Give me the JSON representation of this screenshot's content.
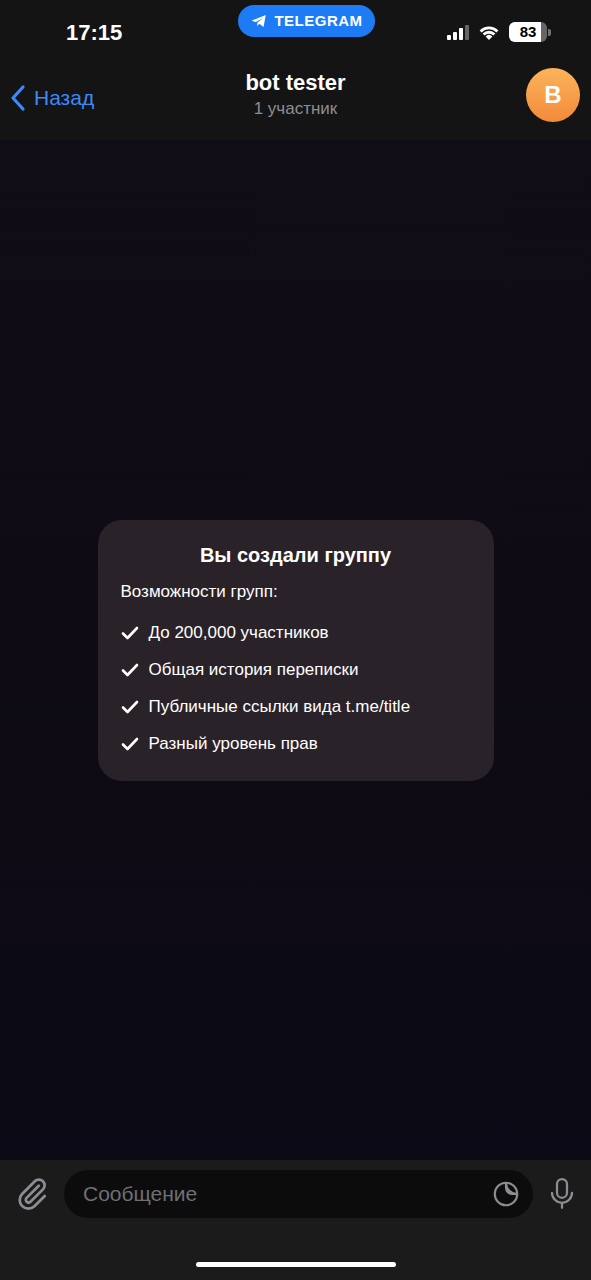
{
  "status_bar": {
    "time": "17:15",
    "app_pill": "TELEGRAM",
    "battery": "83",
    "battery_level": 0.83,
    "signal_level": 0.75
  },
  "header": {
    "back": "Назад",
    "title": "bot tester",
    "subtitle": "1 участник",
    "avatar": "B"
  },
  "service_card": {
    "title": "Вы создали группу",
    "subtitle": "Возможности групп:",
    "features": [
      "До 200,000 участников",
      "Общая история переписки",
      "Публичные ссылки вида t.me/title",
      "Разный уровень прав"
    ]
  },
  "composer": {
    "placeholder": "Сообщение"
  }
}
